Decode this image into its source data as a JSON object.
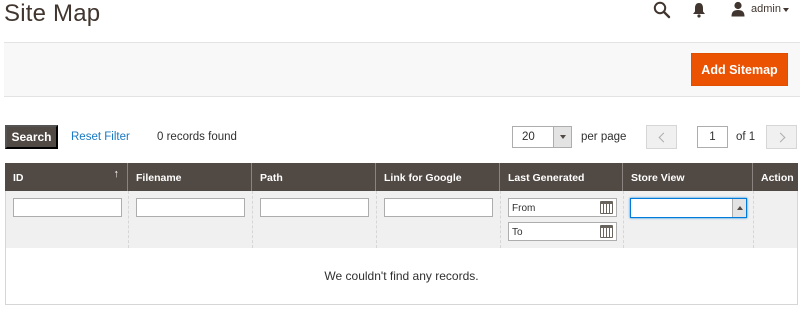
{
  "page": {
    "title": "Site Map"
  },
  "header": {
    "icons": [
      "search-icon",
      "bell-icon",
      "user-icon",
      "chevron-down-icon"
    ],
    "user_label": "admin"
  },
  "actions": {
    "add_button_label": "Add Sitemap"
  },
  "toolbar": {
    "search_label": "Search",
    "reset_filter_label": "Reset Filter",
    "records_found": "0 records found",
    "per_page_value": "20",
    "per_page_label": "per page",
    "page_value": "1",
    "page_total": "of 1"
  },
  "grid": {
    "columns": [
      "ID",
      "Filename",
      "Path",
      "Link for Google",
      "Last Generated",
      "Store View",
      "Action"
    ],
    "sort_indicator": "↑",
    "date_from_placeholder": "From",
    "date_to_placeholder": "To",
    "empty_message": "We couldn't find any records."
  },
  "colors": {
    "accent": "#eb5202",
    "header_bg": "#514943",
    "link": "#1979c3"
  }
}
